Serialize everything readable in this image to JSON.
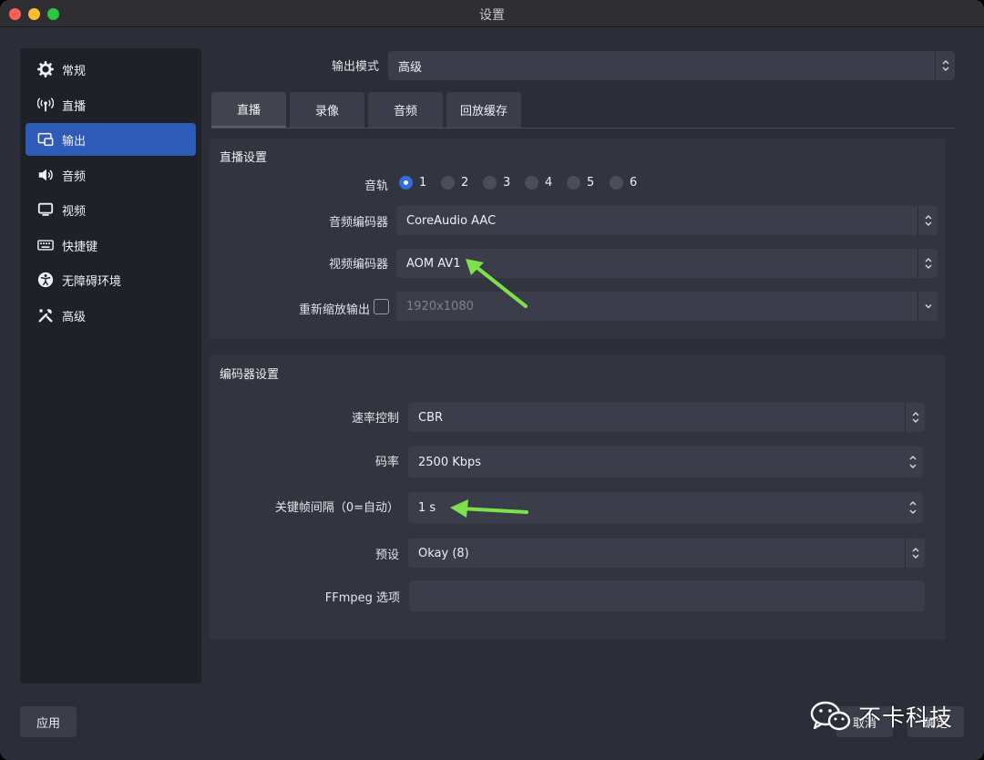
{
  "window": {
    "title": "设置"
  },
  "sidebar": {
    "items": [
      {
        "label": "常规",
        "icon": "gear-icon"
      },
      {
        "label": "直播",
        "icon": "broadcast-icon"
      },
      {
        "label": "输出",
        "icon": "output-icon",
        "active": true
      },
      {
        "label": "音频",
        "icon": "speaker-icon"
      },
      {
        "label": "视频",
        "icon": "monitor-icon"
      },
      {
        "label": "快捷键",
        "icon": "keyboard-icon"
      },
      {
        "label": "无障碍环境",
        "icon": "accessibility-icon"
      },
      {
        "label": "高级",
        "icon": "tools-icon"
      }
    ]
  },
  "output_mode": {
    "label": "输出模式",
    "value": "高级"
  },
  "tabs": [
    {
      "label": "直播",
      "active": true
    },
    {
      "label": "录像"
    },
    {
      "label": "音频"
    },
    {
      "label": "回放缓存"
    }
  ],
  "stream_settings": {
    "title": "直播设置",
    "audio_track": {
      "label": "音轨",
      "options": [
        "1",
        "2",
        "3",
        "4",
        "5",
        "6"
      ],
      "selected": "1"
    },
    "audio_encoder": {
      "label": "音频编码器",
      "value": "CoreAudio AAC"
    },
    "video_encoder": {
      "label": "视频编码器",
      "value": "AOM AV1"
    },
    "rescale": {
      "label": "重新缩放输出",
      "checked": false,
      "value": "1920x1080"
    }
  },
  "encoder_settings": {
    "title": "编码器设置",
    "rate_control": {
      "label": "速率控制",
      "value": "CBR"
    },
    "bitrate": {
      "label": "码率",
      "value": "2500 Kbps"
    },
    "keyframe": {
      "label": "关键帧间隔（0=自动）",
      "value": "1 s"
    },
    "preset": {
      "label": "预设",
      "value": "Okay (8)"
    },
    "ffmpeg_options": {
      "label": "FFmpeg 选项",
      "value": ""
    }
  },
  "buttons": {
    "apply": "应用",
    "cancel": "取消",
    "ok": "确定"
  },
  "watermark": {
    "text": "不卡科技"
  },
  "colors": {
    "accent": "#2e5bb8",
    "annotation_arrow": "#7ee04a"
  }
}
